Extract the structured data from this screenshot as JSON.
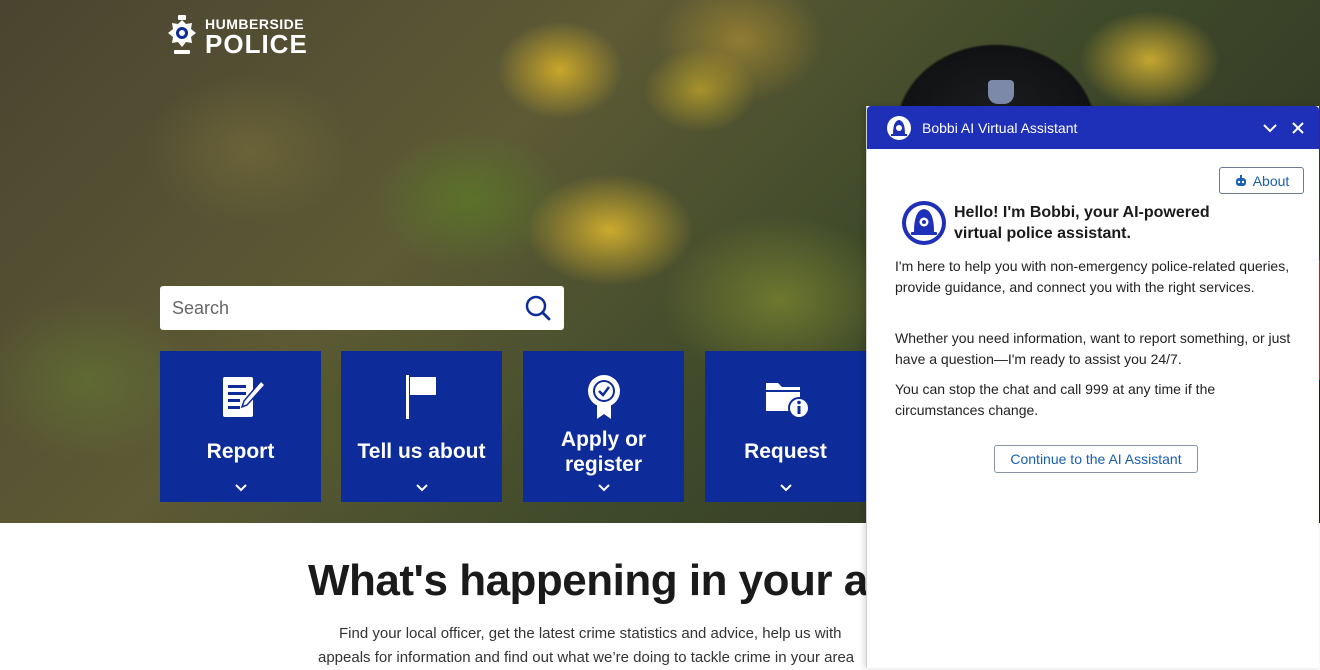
{
  "brand": {
    "name_small": "HUMBERSIDE",
    "name_big": "POLICE"
  },
  "search": {
    "placeholder": "Search"
  },
  "tiles": [
    {
      "label": "Report",
      "icon": "report-form-icon"
    },
    {
      "label": "Tell us about",
      "icon": "flag-icon"
    },
    {
      "label_line1": "Apply or",
      "label_line2": "register",
      "icon": "award-rosette-icon"
    },
    {
      "label": "Request",
      "icon": "folder-info-icon"
    }
  ],
  "main": {
    "heading": "What's happening in your area",
    "sub_line1": "Find your local officer, get the latest crime statistics and advice, help us with",
    "sub_line2": "appeals for information and find out what we’re doing to tackle crime in your area"
  },
  "chat": {
    "title": "Bobbi AI Virtual Assistant",
    "about_label": "About",
    "greeting": "Hello! I'm Bobbi, your AI-powered virtual police assistant.",
    "para1": "I'm here to help you with non-emergency police-related queries, provide guidance, and connect you with the right services.",
    "para2": "Whether you need information, want to report something, or just have a question—I'm ready to assist you 24/7.",
    "para3": "You can stop the chat and call 999 at any time if the circumstances change.",
    "continue_label": "Continue to the AI Assistant"
  },
  "colors": {
    "tile_blue": "#0d2b99",
    "chat_header": "#1e2fb8",
    "link_blue": "#1a5fb4"
  }
}
